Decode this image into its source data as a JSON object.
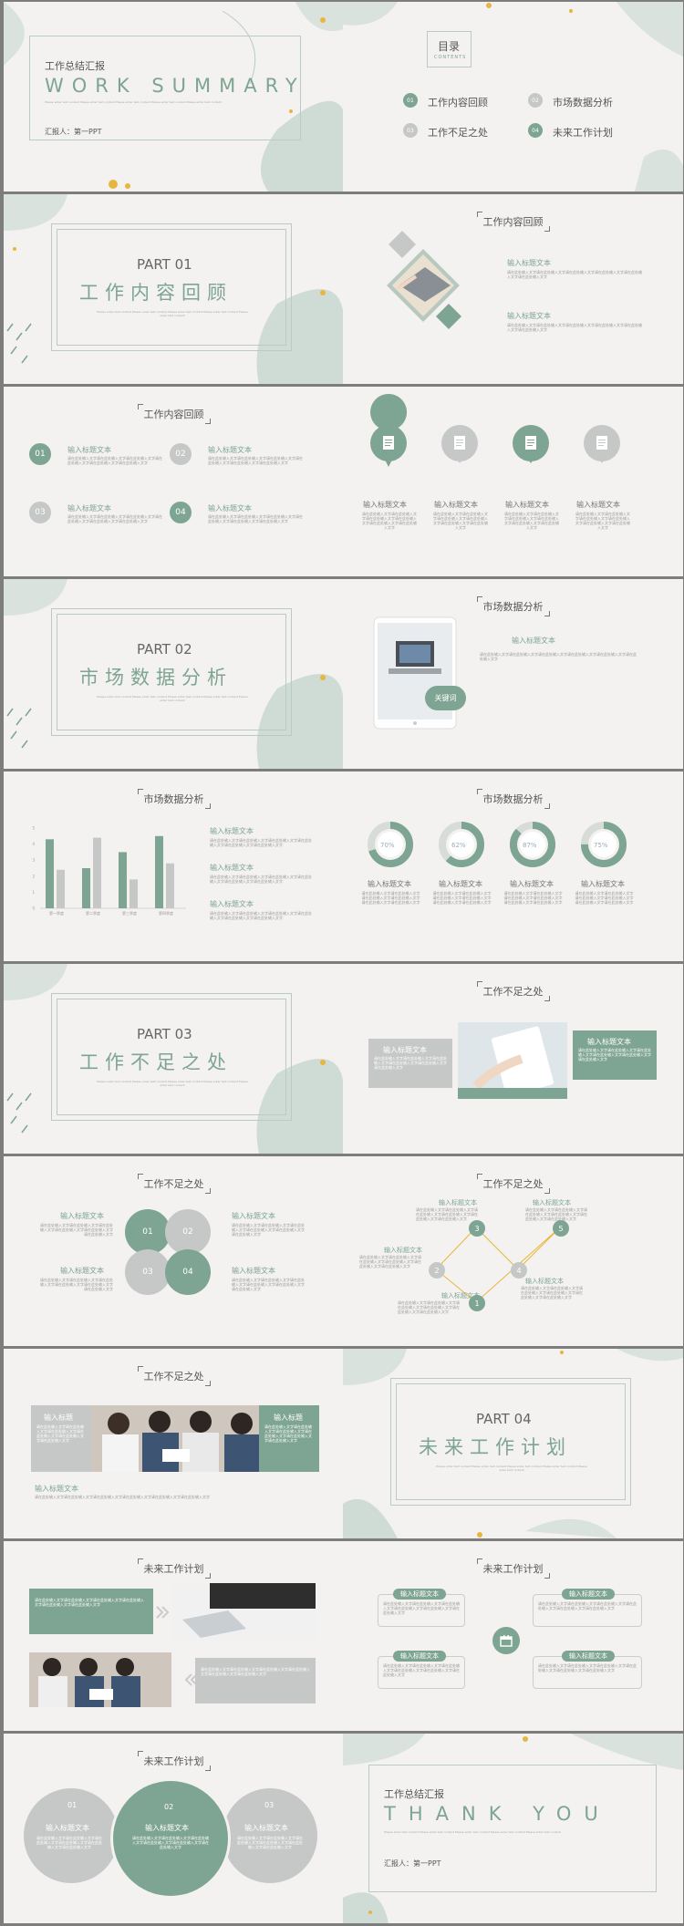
{
  "colors": {
    "accent": "#7ea493",
    "gray": "#c6c7c7",
    "gold": "#e7b63c",
    "bg": "#f3f2f0"
  },
  "placeholder": "Please enter text content Please enter text content Please enter text content Please enter text content Please enter text content",
  "cn_placeholder": "请在此处输入文字请在此处输入文字请在此处输入文字请在此处输入文字请在此处输入文字请在此处输入文字",
  "s1": {
    "title_cn": "工作总结汇报",
    "title_en": "WORK SUMMARY",
    "reporter": "汇报人：第一PPT"
  },
  "s2": {
    "toc": "目录",
    "contents": "CONTENTS",
    "items": [
      {
        "num": "01",
        "text": "工作内容回顾"
      },
      {
        "num": "02",
        "text": "市场数据分析"
      },
      {
        "num": "03",
        "text": "工作不足之处"
      },
      {
        "num": "04",
        "text": "未来工作计划"
      }
    ]
  },
  "s3": {
    "part": "PART 01",
    "title": "工作内容回顾"
  },
  "s4": {
    "title": "工作内容回顾",
    "h1": "输入标题文本",
    "h2": "输入标题文本"
  },
  "s5": {
    "title": "工作内容回顾",
    "items": [
      {
        "n": "01",
        "h": "输入标题文本"
      },
      {
        "n": "02",
        "h": "输入标题文本"
      },
      {
        "n": "03",
        "h": "输入标题文本"
      },
      {
        "n": "04",
        "h": "输入标题文本"
      }
    ]
  },
  "s6": {
    "heads": [
      "输入标题文本",
      "输入标题文本",
      "输入标题文本",
      "输入标题文本"
    ]
  },
  "s7": {
    "part": "PART 02",
    "title": "市场数据分析"
  },
  "s8": {
    "title": "市场数据分析",
    "head": "输入标题文本",
    "keyword": "关键词"
  },
  "s9": {
    "title": "市场数据分析",
    "heads": [
      "输入标题文本",
      "输入标题文本",
      "输入标题文本"
    ]
  },
  "chart_data": {
    "type": "bar",
    "categories": [
      "第一季度",
      "第二季度",
      "第三季度",
      "第四季度"
    ],
    "series": [
      {
        "values": [
          4.3,
          2.5,
          3.5,
          4.5
        ]
      },
      {
        "values": [
          2.4,
          4.4,
          1.8,
          2.8
        ]
      }
    ],
    "ylim": [
      0,
      5
    ],
    "yticks": [
      "0",
      "1",
      "2",
      "3",
      "4",
      "5"
    ]
  },
  "s10": {
    "title": "市场数据分析",
    "rings": [
      {
        "pct": "70%",
        "v": 0.7
      },
      {
        "pct": "62%",
        "v": 0.62
      },
      {
        "pct": "87%",
        "v": 0.87
      },
      {
        "pct": "75%",
        "v": 0.75
      }
    ],
    "heads": [
      "输入标题文本",
      "输入标题文本",
      "输入标题文本",
      "输入标题文本"
    ]
  },
  "s11": {
    "part": "PART 03",
    "title": "工作不足之处"
  },
  "s12": {
    "title": "工作不足之处",
    "h1": "输入标题文本",
    "h2": "输入标题文本"
  },
  "s13": {
    "title": "工作不足之处",
    "nums": [
      "01",
      "02",
      "03",
      "04"
    ],
    "heads": [
      "输入标题文本",
      "输入标题文本",
      "输入标题文本",
      "输入标题文本"
    ]
  },
  "s14": {
    "title": "工作不足之处",
    "nums": [
      "1",
      "2",
      "3",
      "4",
      "5"
    ],
    "heads": [
      "输入标题文本",
      "输入标题文本",
      "输入标题文本",
      "输入标题文本",
      "输入标题文本"
    ]
  },
  "s15": {
    "title": "工作不足之处",
    "h1": "输入标题",
    "h2": "输入标题",
    "h3": "输入标题文本"
  },
  "s16": {
    "part": "PART 04",
    "title": "未来工作计划"
  },
  "s17": {
    "title": "未来工作计划"
  },
  "s18": {
    "title": "未来工作计划",
    "heads": [
      "输入标题文本",
      "输入标题文本",
      "输入标题文本",
      "输入标题文本"
    ]
  },
  "s19": {
    "title": "未来工作计划",
    "items": [
      {
        "n": "01",
        "h": "输入标题文本"
      },
      {
        "n": "02",
        "h": "输入标题文本"
      },
      {
        "n": "03",
        "h": "输入标题文本"
      }
    ]
  },
  "s20": {
    "title_cn": "工作总结汇报",
    "title_en": "THANK YOU",
    "reporter": "汇报人：第一PPT"
  }
}
